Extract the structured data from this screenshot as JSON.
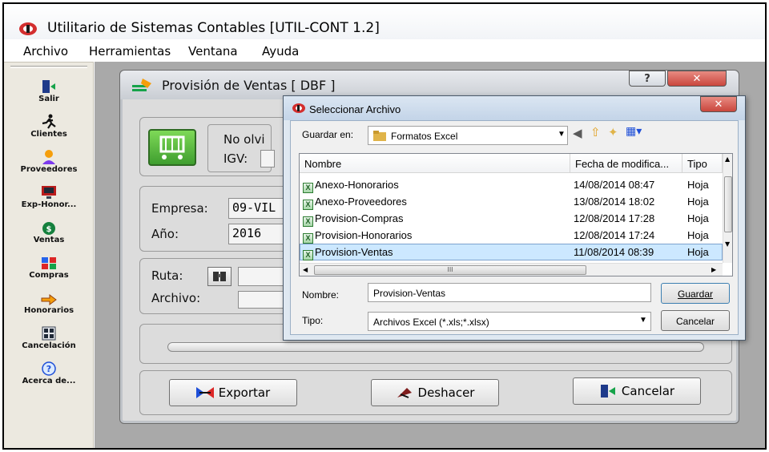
{
  "app": {
    "title": "Utilitario de Sistemas Contables [UTIL-CONT 1.2]"
  },
  "menu": [
    "Archivo",
    "Herramientas",
    "Ventana",
    "Ayuda"
  ],
  "sidebar": [
    {
      "label": "Salir",
      "icon": "exit-door-icon"
    },
    {
      "label": "Clientes",
      "icon": "running-man-icon"
    },
    {
      "label": "Proveedores",
      "icon": "user-icon"
    },
    {
      "label": "Exp-Honor...",
      "icon": "monitor-icon"
    },
    {
      "label": "Ventas",
      "icon": "money-bag-icon"
    },
    {
      "label": "Compras",
      "icon": "shopping-icon"
    },
    {
      "label": "Honorarios",
      "icon": "hand-pointer-icon"
    },
    {
      "label": "Cancelación",
      "icon": "calculator-icon"
    },
    {
      "label": "Acerca de...",
      "icon": "help-icon"
    }
  ],
  "child_window": {
    "title": "Provisión de Ventas [ DBF ]",
    "notice": "No olvi",
    "igv_label": "IGV:",
    "empresa_label": "Empresa:",
    "empresa_value": "09-VIL",
    "anio_label": "Año:",
    "anio_value": "2016",
    "ruta_label": "Ruta:",
    "archivo_label": "Archivo:",
    "btn_exportar": "Exportar",
    "btn_deshacer": "Deshacer",
    "btn_cancelar": "Cancelar"
  },
  "dialog": {
    "title": "Seleccionar Archivo",
    "save_in_label": "Guardar en:",
    "save_in_value": "Formatos Excel",
    "columns": [
      "Nombre",
      "Fecha de modifica...",
      "Tipo"
    ],
    "files": [
      {
        "name": "Anexo-Honorarios",
        "date": "14/08/2014 08:47",
        "type": "Hoja"
      },
      {
        "name": "Anexo-Proveedores",
        "date": "13/08/2014 18:02",
        "type": "Hoja"
      },
      {
        "name": "Provision-Compras",
        "date": "12/08/2014 17:28",
        "type": "Hoja"
      },
      {
        "name": "Provision-Honorarios",
        "date": "12/08/2014 17:24",
        "type": "Hoja"
      },
      {
        "name": "Provision-Ventas",
        "date": "11/08/2014 08:39",
        "type": "Hoja"
      }
    ],
    "selected_file": "Provision-Ventas",
    "name_label": "Nombre:",
    "name_value": "Provision-Ventas",
    "type_label": "Tipo:",
    "type_value": "Archivos Excel (*.xls;*.xlsx)",
    "btn_save": "Guardar",
    "btn_cancel": "Cancelar",
    "scroll_marker": "III"
  },
  "colors": {
    "selection": "#cce8ff",
    "close_red": "#c9463d",
    "mdi_bg": "#a9a9a9"
  }
}
